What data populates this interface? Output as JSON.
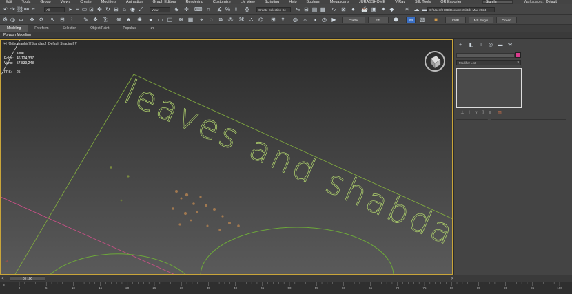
{
  "menubar": {
    "items": [
      "Edit",
      "Tools",
      "Group",
      "Views",
      "Create",
      "Modifiers",
      "Animation",
      "Graph Editors",
      "Rendering",
      "Customize",
      "LM View",
      "Scripting",
      "Help",
      "Boolean",
      "Megascans",
      "JURASSHOME",
      "V-Ray",
      "Silk Tools",
      "OR Exporter"
    ],
    "sign_in": "Sign In",
    "workspaces_label": "Workspaces:",
    "workspaces_value": "Default"
  },
  "toolbar": {
    "selection_filter": "All",
    "ref_coord": "View",
    "named_selection": "Create Selection Se",
    "project_path": "C:\\Users\\HOD\\Documents\\3ds Max 2024",
    "buttons": [
      "Crafter",
      "FTL",
      "RB",
      "KMP",
      "MS Plugin",
      "Ocean"
    ]
  },
  "ribbon": {
    "tabs": [
      "Modeling",
      "Freeform",
      "Selection",
      "Object Paint",
      "Populate"
    ],
    "active_tab": "Modeling",
    "sub_label": "Polygon Modeling"
  },
  "viewport": {
    "label": "[+] [Orthographic] [Standard] [Default Shading]",
    "stats_title": "Total",
    "polys_label": "Polys:",
    "polys_value": "46,124,337",
    "verts_label": "Verts:",
    "verts_value": "57,839,248",
    "fps_label": "FPS:",
    "fps_value": "25",
    "text_line1": "leaves and shabdar",
    "colors": {
      "border": "#c9a53a",
      "wire": "#7fa83f",
      "axis": "#d0508a"
    }
  },
  "command_panel": {
    "tab_icons": [
      "create-icon",
      "modify-icon",
      "hierarchy-icon",
      "motion-icon",
      "display-icon",
      "utilities-icon"
    ],
    "modifier_list": "Modifier List",
    "swatch_color": "#d93b8c"
  },
  "timeslider": {
    "frame_display": "0 / 100"
  },
  "trackbar": {
    "ticks": [
      "0",
      "5",
      "10",
      "15",
      "20",
      "25",
      "30",
      "35",
      "40",
      "45",
      "50",
      "55",
      "60",
      "65",
      "70",
      "75",
      "80",
      "85",
      "90",
      "95",
      "100"
    ]
  }
}
